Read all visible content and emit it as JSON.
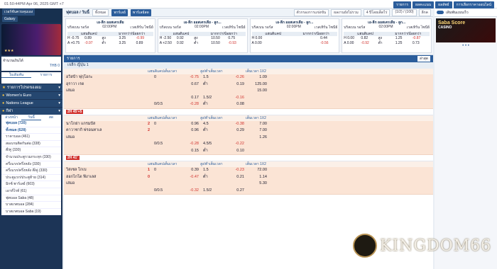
{
  "topbar": {
    "time": "01:50:44PM Apr 06, 2025 GMT +7",
    "buttons": [
      "รายการ",
      "ผลคะแนน",
      "ผลลัพธ์",
      "การเลือกราคาออนไลน์"
    ]
  },
  "sidebar": {
    "buttons": [
      "เวอร์ชั่นควบคุมเอง",
      "Galaxy"
    ],
    "balance_label": "จำนวนเงินได้",
    "balance_value": "THB 0",
    "tabs": [
      "ใบเดิมพัน",
      "รายการ"
    ],
    "sections": [
      {
        "label": "รายการโปรดของผม",
        "icon": "star-icon"
      },
      {
        "label": "Women's Euro",
        "icon": "ball-icon"
      },
      {
        "label": "Nations League",
        "icon": "ball-icon"
      },
      {
        "label": "กีฬา",
        "icon": "ball-icon"
      }
    ],
    "sport_tabs": [
      "ล่วงหน้า",
      "วันนี้",
      "สด"
    ],
    "sport_items": [
      "ฟุตบอล (720)",
      "ทั้งหมด (628)",
      "ราคาบอล (461)",
      "สองเกมติดกันต่อ (338)",
      "คี่/คู่ (330)",
      "จำนวนประตูรวมกระทุก (330)",
      "ครึ่งแรก/ครึ่งหลัง (330)",
      "ครึ่งแรก/ครึ่งหลัง คี่/คู่ (330)",
      "ประตูแรก/ประตูท้าย (314)",
      "มิกซ์ พาร์เลย์ (603)",
      "เอาท์ไรท์ (61)",
      "ฟุตบอล Saba (48)",
      "บาสเกตบอล (284)",
      "บาสเกตบอล Saba (19)"
    ]
  },
  "filters": {
    "title": "ฟุตบอล / วันนี้",
    "select": "ทั้งหมด",
    "chip1": "พาร์เลย์",
    "chip2": "พาร์เลย์สด",
    "sort": "ตัวกรองการแข่งขัน",
    "odds": "ผลงานยังไม่รวม",
    "view": "4 ปีโดยเต็ดไร่",
    "pages": "(1/2) / (100)",
    "lines": "ลีกค"
  },
  "cards": [
    {
      "league": "เอ-ลีก ออสเตรเลีย",
      "home": "บริสเบน รอร์ส",
      "time": "02:00PM",
      "away": "เวสเทิร์น ไซนีย์",
      "h": [
        "-0.75",
        "0.89",
        "สูง",
        "3.25",
        "-0.99"
      ],
      "a": [
        "+0.75",
        "-0.97",
        "ต่ำ",
        "3.25",
        "0.89"
      ]
    },
    {
      "league": "เอ-ลีก ออสเตรเลีย - ลูก...",
      "home": "บริสเบน รอร์ส",
      "time": "02:00PM",
      "away": "เวสเทิร์น ไซนีย์",
      "h": [
        "-2.50",
        "0.92",
        "สูง",
        "10.50",
        "0.75"
      ],
      "a": [
        "+2.50",
        "0.92",
        "ต่ำ",
        "10.50",
        "-0.93"
      ]
    },
    {
      "league": "เอ-ลีก ออสเตรเลีย - ลูก...",
      "home": "บริสเบน รอร์ส",
      "time": "02:00PM",
      "away": "เวสเทิร์น ไซนีย์",
      "h": [
        "0.00",
        "",
        "",
        "",
        "0.44"
      ],
      "a": [
        "0.00",
        "",
        "",
        "",
        "-0.56"
      ]
    },
    {
      "league": "เอ-ลีก ออสเตรเลีย - ลูก...",
      "home": "บริสเบน รอร์ส",
      "time": "02:00PM",
      "away": "เวสเทิร์น ไซนีย์",
      "h": [
        "0.00",
        "0.82",
        "สูง",
        "1.25",
        "-0.87"
      ],
      "a": [
        "0.00",
        "-0.92",
        "ต่ำ",
        "1.25",
        "0.73"
      ]
    }
  ],
  "card_headers": [
    "แฮนดิแคป",
    "มากกว่า/น้อยกว่า"
  ],
  "section": {
    "title": "รายการ",
    "sort": "ล่าสุด",
    "league": "เจลีก ญี่ปุ่น 1"
  },
  "columns": [
    "แฮนดิแคปเต็มเวลา",
    "สูง/ต่ำเต็มเวลา",
    "เต็มเวลา 1X2"
  ],
  "matches": [
    {
      "live": "",
      "home": "อวิสป้า ฟุกุโอกะ",
      "away": "อุราวา เรด",
      "draw": "เสมอ",
      "hs": "",
      "as": "",
      "rows": [
        [
          "0",
          "-0.75",
          "1.5",
          "-0.26",
          "1.09"
        ],
        [
          "",
          "0.67",
          "ต่ำ",
          "0.19",
          "125.00"
        ],
        [
          "",
          "",
          "",
          "",
          "15.00"
        ]
      ],
      "sub": [
        [
          "",
          "0.17",
          "1.5/2",
          "-0.16"
        ],
        [
          "0/0.5",
          "-0.28",
          "ต่ำ",
          "0.08"
        ]
      ]
    },
    {
      "live": "2H 45'+5",
      "home": "นาโกย่า แกรมปัส",
      "away": "คาวาซากิ ฟรอนทาเล",
      "draw": "เสมอ",
      "hs": "2",
      "as": "2",
      "rows": [
        [
          "0",
          "0.96",
          "4.5",
          "-0.38",
          "7.00"
        ],
        [
          "",
          "0.96",
          "ต่ำ",
          "0.29",
          "7.00"
        ],
        [
          "",
          "",
          "",
          "",
          "1.26"
        ]
      ],
      "sub": [
        [
          "0/0.5",
          "-0.28",
          "4.5/5",
          "-0.22"
        ],
        [
          "",
          "0.15",
          "ต่ำ",
          "0.10"
        ]
      ]
    },
    {
      "live": "2H 41'",
      "home": "วิสเซล โกเบ",
      "away": "ฮอกไกโด ฟิงาเลส",
      "draw": "เสมอ",
      "hs": "1",
      "as": "0",
      "rows": [
        [
          "0",
          "0.39",
          "1.5",
          "-0.23",
          "72.00"
        ],
        [
          "",
          "-0.47",
          "ต่ำ",
          "0.21",
          "1.14"
        ],
        [
          "",
          "",
          "",
          "",
          "5.30"
        ]
      ],
      "sub": [
        [
          "0/0.5",
          "-0.32",
          "1.5/2",
          "0.27"
        ]
      ]
    }
  ],
  "right": {
    "toggle_label": "เดิมพันแบบเร็ว",
    "ad_title": "Saba Score",
    "ad_sub": "CASINO"
  },
  "watermark": "KINGDOM66"
}
